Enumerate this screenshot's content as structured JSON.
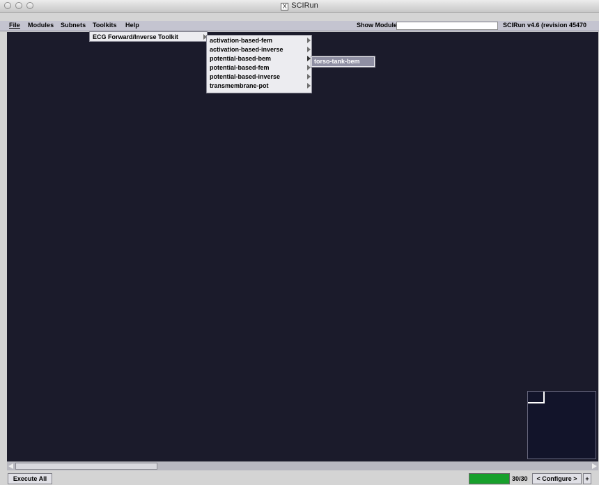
{
  "window": {
    "title": "SCIRun"
  },
  "menubar": {
    "file": "File",
    "modules": "Modules",
    "subnets": "Subnets",
    "toolkits": "Toolkits",
    "help": "Help",
    "show_module_label": "Show Module:",
    "show_module_value": "",
    "version": "SCIRun v4.6 (revision 45470"
  },
  "toolkits_menu": {
    "items": [
      "ECG Forward/Inverse Toolkit"
    ]
  },
  "ecg_submenu": {
    "items": [
      "activation-based-fem",
      "activation-based-inverse",
      "potential-based-bem",
      "potential-based-fem",
      "potential-based-inverse",
      "transmembrane-pot"
    ]
  },
  "bem_submenu": {
    "items": [
      "torso-tank-bem"
    ]
  },
  "statusbar": {
    "execute_all": "Execute All",
    "count": "30/30",
    "configure": "< Configure >",
    "plus": "+",
    "progress_fraction": 1.0,
    "progress_color": "#18a02c"
  },
  "colors": {
    "canvas": "#1b1b2b",
    "selection": "#8f8fa3"
  }
}
